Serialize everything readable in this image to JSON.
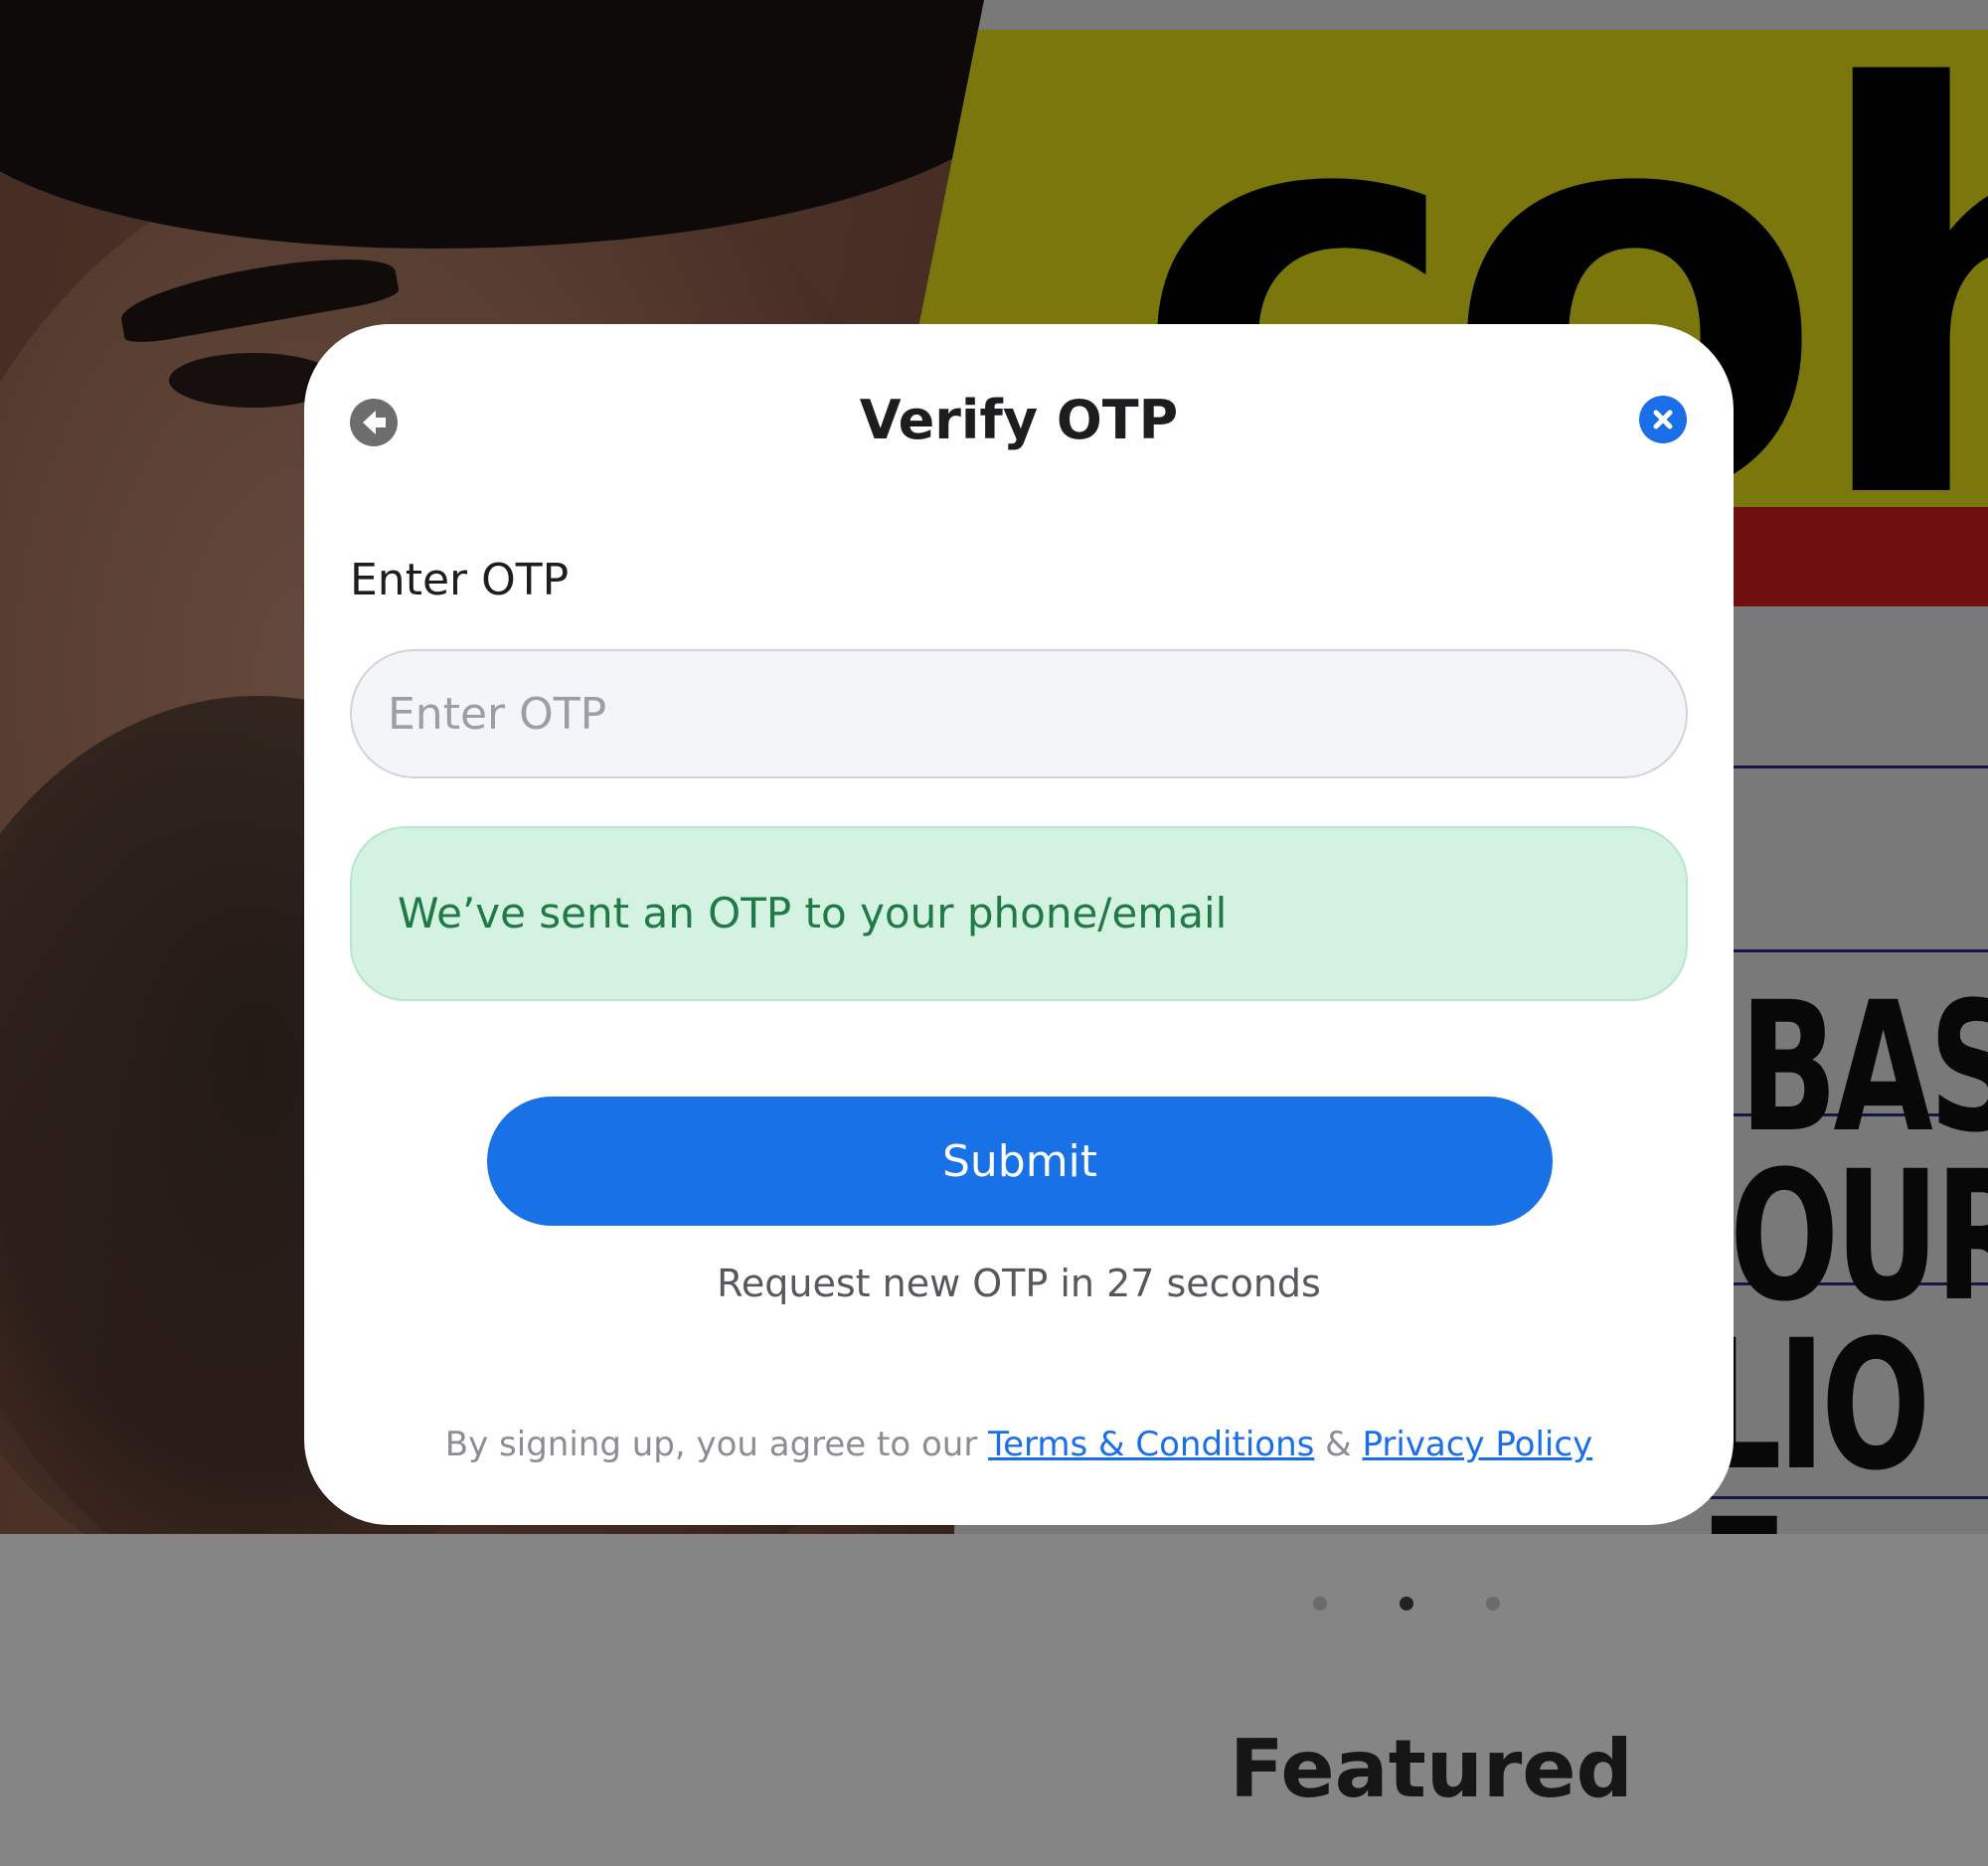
{
  "background": {
    "poster_word": "coh",
    "poster_lines": [
      "BASI",
      "OURC",
      "LIO F"
    ]
  },
  "carousel": {
    "dots": [
      {
        "active": false
      },
      {
        "active": true
      },
      {
        "active": false
      }
    ]
  },
  "page": {
    "featured_heading": "Featured"
  },
  "modal": {
    "title": "Verify OTP",
    "back_icon": "arrow-left-icon",
    "close_icon": "close-icon",
    "field_label": "Enter OTP",
    "input_placeholder": "Enter OTP",
    "input_value": "",
    "notice": "We’ve sent an OTP to your phone/email",
    "submit_label": "Submit",
    "resend_text": "Request new OTP in 27 seconds",
    "legal": {
      "prefix": "By signing up, you agree to our",
      "terms_link": "Terms & Conditions",
      "separator": "&",
      "privacy_link": "Privacy Policy"
    }
  },
  "colors": {
    "accent": "#1a6ee8",
    "success_bg": "#d3f2e1",
    "success_text": "#1f7a46"
  }
}
